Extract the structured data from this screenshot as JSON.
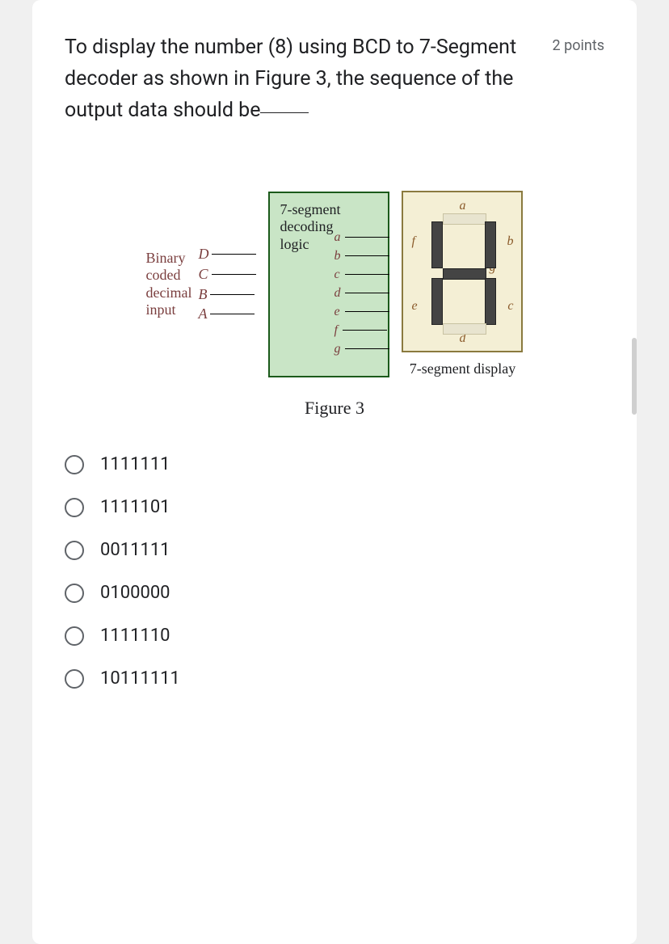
{
  "question": {
    "text_part1": "To display the number (8) using BCD to 7-Segment decoder as shown in Figure 3, the sequence of the output data should be",
    "points": "2 points"
  },
  "figure": {
    "input_label_l1": "Binary",
    "input_label_l2": "coded",
    "input_label_l3": "decimal",
    "input_label_l4": "input",
    "input_pins": [
      "D",
      "C",
      "B",
      "A"
    ],
    "decoder_l1": "7-segment",
    "decoder_l2": "decoding",
    "decoder_l3": "logic",
    "output_pins": [
      "a",
      "b",
      "c",
      "d",
      "e",
      "f",
      "g"
    ],
    "seg_labels": {
      "a": "a",
      "b": "b",
      "c": "c",
      "d": "d",
      "e": "e",
      "f": "f",
      "g": "g"
    },
    "display_caption": "7-segment display",
    "caption": "Figure 3"
  },
  "options": [
    {
      "label": "1111111"
    },
    {
      "label": "1111101"
    },
    {
      "label": "0011111"
    },
    {
      "label": "0100000"
    },
    {
      "label": "1111110"
    },
    {
      "label": "10111111"
    }
  ]
}
